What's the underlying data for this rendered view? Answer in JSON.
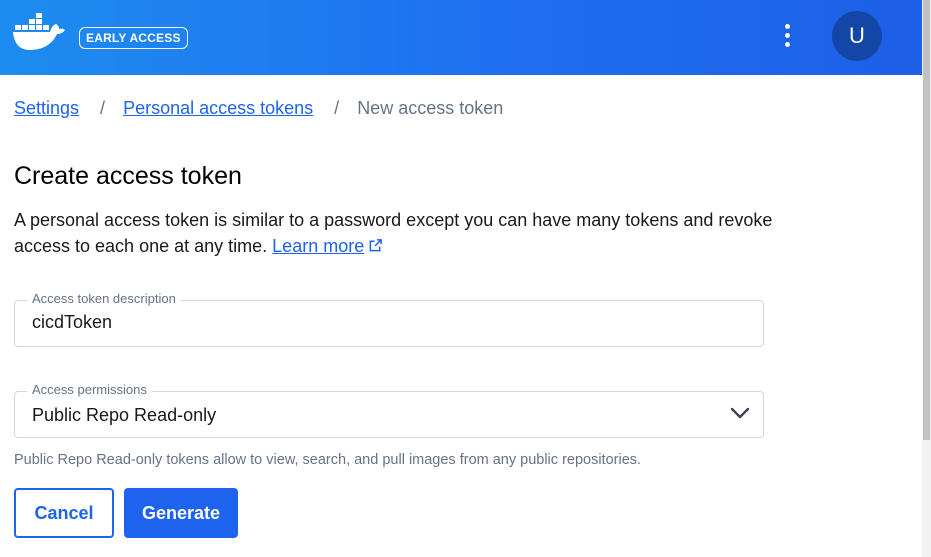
{
  "header": {
    "badge": "EARLY ACCESS",
    "avatar_initial": "U",
    "logo_icon": "docker-whale-icon",
    "menu_icon": "kebab-menu-icon",
    "gradient_start": "#1d8cf0",
    "gradient_end": "#1d5fe6"
  },
  "breadcrumb": {
    "items": [
      "Settings",
      "Personal access tokens",
      "New access token"
    ],
    "separator": "/"
  },
  "page": {
    "title": "Create access token",
    "description": "A personal access token is similar to a password except you can have many tokens and revoke access to each one at any time.",
    "learn_more": "Learn more",
    "learn_more_icon": "external-link-icon"
  },
  "form": {
    "description_field": {
      "label": "Access token description",
      "value": "cicdToken"
    },
    "permissions_field": {
      "label": "Access permissions",
      "selected": "Public Repo Read-only",
      "helper": "Public Repo Read-only tokens allow to view, search, and pull images from any public repositories."
    },
    "cancel_label": "Cancel",
    "generate_label": "Generate"
  },
  "colors": {
    "primary": "#1d63ed",
    "muted_text": "#677285"
  }
}
